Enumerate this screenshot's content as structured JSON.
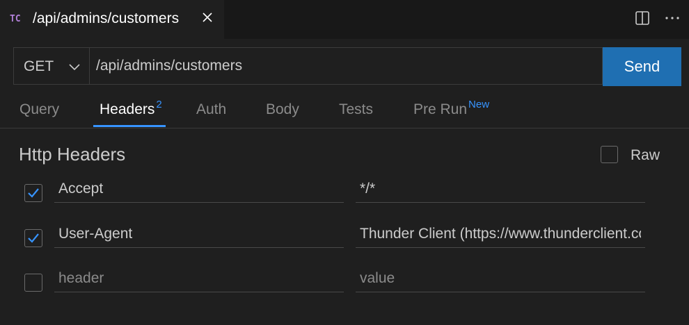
{
  "tab": {
    "logo": "TC",
    "title": "/api/admins/customers"
  },
  "request": {
    "method": "GET",
    "url": "/api/admins/customers",
    "send_label": "Send"
  },
  "request_tabs": [
    {
      "label": "Query"
    },
    {
      "label": "Headers",
      "badge": "2"
    },
    {
      "label": "Auth"
    },
    {
      "label": "Body"
    },
    {
      "label": "Tests"
    },
    {
      "label": "Pre Run",
      "badge": "New"
    }
  ],
  "active_tab": "Headers",
  "headers_section": {
    "title": "Http Headers",
    "raw_label": "Raw",
    "raw_checked": false,
    "rows": [
      {
        "checked": true,
        "key": "Accept",
        "value": "*/*"
      },
      {
        "checked": true,
        "key": "User-Agent",
        "value": "Thunder Client (https://www.thunderclient.com)"
      },
      {
        "checked": false,
        "key": "",
        "value": "",
        "key_placeholder": "header",
        "value_placeholder": "value"
      }
    ]
  },
  "colors": {
    "accent": "#3794ff",
    "send_button": "#1f6fb2",
    "logo": "#b180d7"
  },
  "icons": {
    "close": "close-icon",
    "split": "split-editor-icon",
    "more": "more-icon",
    "chevron": "chevron-down-icon",
    "check": "check-icon"
  }
}
